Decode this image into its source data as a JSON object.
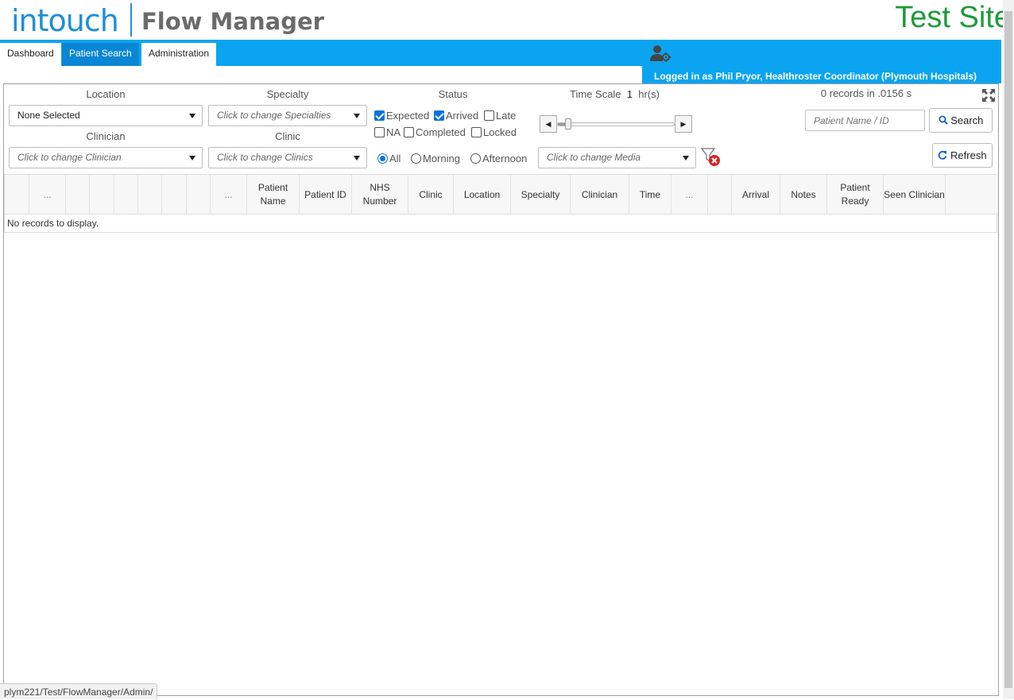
{
  "header": {
    "logo_intouch": "intouch",
    "logo_product": "Flow Manager",
    "site_label": "Test Site"
  },
  "nav": {
    "tabs": [
      {
        "label": "Dashboard"
      },
      {
        "label": "Patient Search"
      },
      {
        "label": "Administration"
      }
    ],
    "logged_in_text": "Logged in as Phil Pryor, Healthroster Coordinator (Plymouth Hospitals)"
  },
  "filters": {
    "location_label": "Location",
    "location_value": "None Selected",
    "specialty_label": "Specialty",
    "specialty_placeholder": "Click to change Specialties",
    "clinician_label": "Clinician",
    "clinician_placeholder": "Click to change Clinician",
    "clinic_label": "Clinic",
    "clinic_placeholder": "Click to change Clinics",
    "status_label": "Status",
    "status_options": [
      {
        "label": "Expected",
        "checked": true
      },
      {
        "label": "Arrived",
        "checked": true
      },
      {
        "label": "Late",
        "checked": false
      },
      {
        "label": "NA",
        "checked": false
      },
      {
        "label": "Completed",
        "checked": false
      },
      {
        "label": "Locked",
        "checked": false
      }
    ],
    "time_options": [
      {
        "label": "All",
        "selected": true
      },
      {
        "label": "Morning",
        "selected": false
      },
      {
        "label": "Afternoon",
        "selected": false
      }
    ],
    "time_scale_label": "Time Scale",
    "time_scale_value": "1",
    "time_scale_unit": "hr(s)",
    "media_placeholder": "Click to change Media",
    "records_info": "0 records in .0156 s",
    "patient_search_placeholder": "Patient Name / ID",
    "search_label": "Search",
    "refresh_label": "Refresh"
  },
  "grid": {
    "columns": [
      "",
      "...",
      "",
      "",
      "",
      "",
      "",
      "",
      "...",
      "Patient Name",
      "Patient ID",
      "NHS Number",
      "Clinic",
      "Location",
      "Specialty",
      "Clinician",
      "Time",
      "...",
      "",
      "Arrival",
      "Notes",
      "Patient Ready",
      "Seen Clinician",
      ""
    ],
    "empty_message": "No records to display."
  },
  "status_bar": {
    "url": "plym221/Test/FlowManager/Admin/"
  },
  "colors": {
    "brand_blue": "#0ba4f0",
    "logo_blue": "#1e8fd6",
    "site_green": "#1f9a3c"
  }
}
